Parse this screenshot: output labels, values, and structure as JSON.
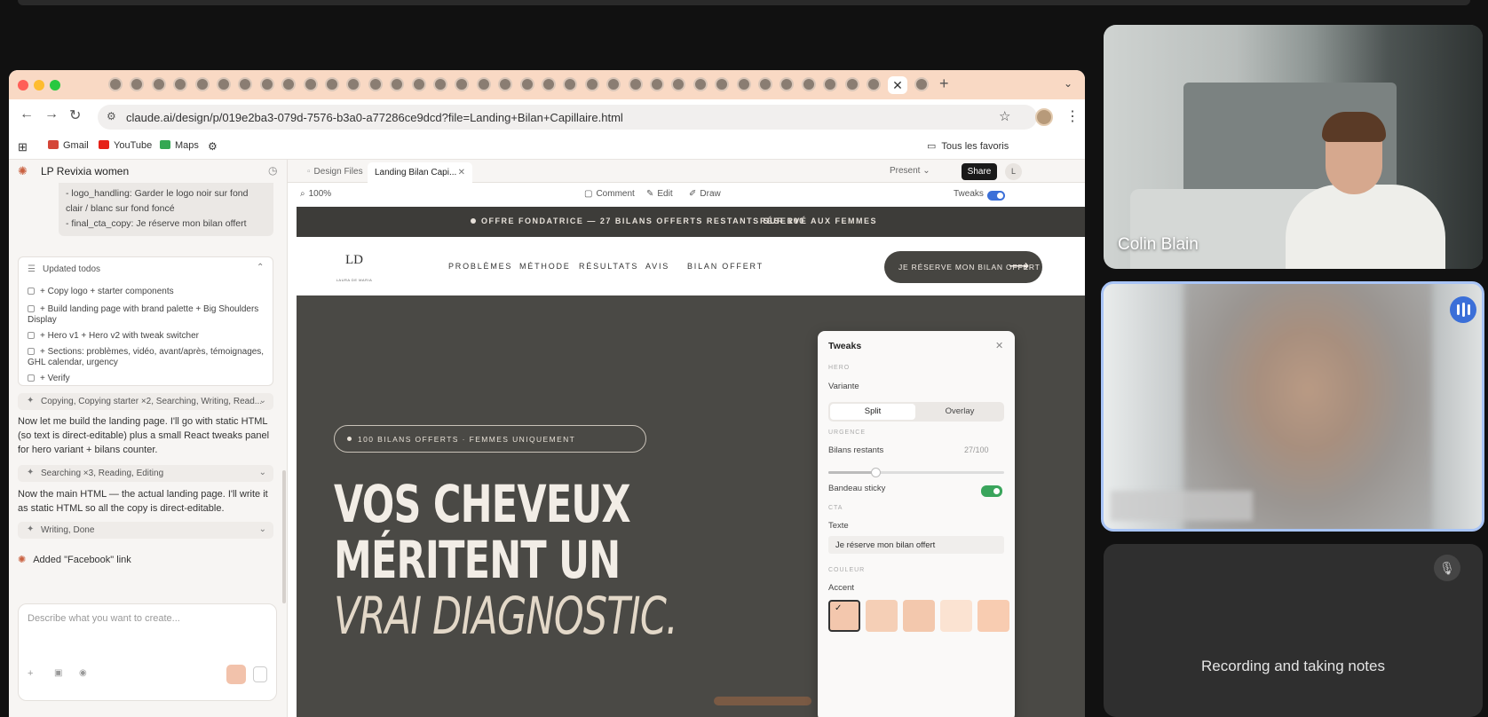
{
  "browser": {
    "url": "claude.ai/design/p/019e2ba3-079d-7576-b3a0-a77286ce9dcd?file=Landing+Bilan+Capillaire.html",
    "bookmarks": [
      {
        "label": "Gmail",
        "color": "#d44638"
      },
      {
        "label": "YouTube",
        "color": "#e62117"
      },
      {
        "label": "Maps",
        "color": "#34a853"
      }
    ],
    "favorites_label": "Tous les favoris"
  },
  "chat": {
    "title": "LP Revixia women",
    "quote_lines": [
      "- logo_handling: Garder le logo noir sur fond",
      "clair / blanc sur fond foncé",
      "- final_cta_copy: Je réserve mon bilan offert"
    ],
    "todos_header": "Updated todos",
    "todos": [
      "+ Copy logo + starter components",
      "+ Build landing page with brand palette + Big Shoulders Display",
      "+ Hero v1 + Hero v2 with tweak switcher",
      "+ Sections: problèmes, vidéo, avant/après, témoignages, GHL calendar, urgency",
      "+ Verify"
    ],
    "tool1": "Copying, Copying starter ×2, Searching, Writing, Read...",
    "msg1": "Now let me build the landing page. I'll go with static HTML (so text is direct-editable) plus a small React tweaks panel for hero variant + bilans counter.",
    "tool2": "Searching ×3, Reading, Editing",
    "msg2": "Now the main HTML — the actual landing page. I'll write it as static HTML so all the copy is direct-editable.",
    "tool3": "Writing, Done",
    "added": "Added \"Facebook\" link",
    "prompt_placeholder": "Describe what you want to create..."
  },
  "design": {
    "tab1": "Design Files",
    "tab2": "Landing Bilan Capi...",
    "present": "Present",
    "share": "Share",
    "avatar_letter": "L",
    "zoom": "100%",
    "comment": "Comment",
    "edit": "Edit",
    "draw": "Draw",
    "tweaks_toggle": "Tweaks"
  },
  "landing": {
    "banner_left": "OFFRE FONDATRICE — 27 BILANS OFFERTS RESTANTS SUR 100",
    "banner_right": "RÉSERVÉ AUX FEMMES",
    "logo": "LD",
    "logo_sub": "LAURA DE MARIA",
    "nav": [
      "PROBLÈMES",
      "MÉTHODE",
      "RÉSULTATS",
      "AVIS",
      "BILAN OFFERT"
    ],
    "cta": "JE RÉSERVE MON BILAN OFFERT",
    "pill": "100 BILANS OFFERTS · FEMMES UNIQUEMENT",
    "hero_line1": "VOS CHEVEUX",
    "hero_line2": "MÉRITENT UN",
    "hero_line3": "VRAI DIAGNOSTIC."
  },
  "tweaks": {
    "title": "Tweaks",
    "sec_hero": "HERO",
    "variant_label": "Variante",
    "opt_split": "Split",
    "opt_overlay": "Overlay",
    "sec_urgence": "URGENCE",
    "bilans_label": "Bilans restants",
    "bilans_value": "27/100",
    "bilans_fraction": 0.27,
    "sticky_label": "Bandeau sticky",
    "sec_cta": "CTA",
    "texte_label": "Texte",
    "texte_value": "Je réserve mon bilan offert",
    "sec_couleur": "COULEUR",
    "accent_label": "Accent",
    "swatches": [
      "#f3c7ad",
      "#f5cfb6",
      "#f3c8ad",
      "#fbe3d2",
      "#f8ccb1"
    ]
  },
  "call": {
    "participant1": "Colin Blain",
    "recording": "Recording and taking notes"
  }
}
